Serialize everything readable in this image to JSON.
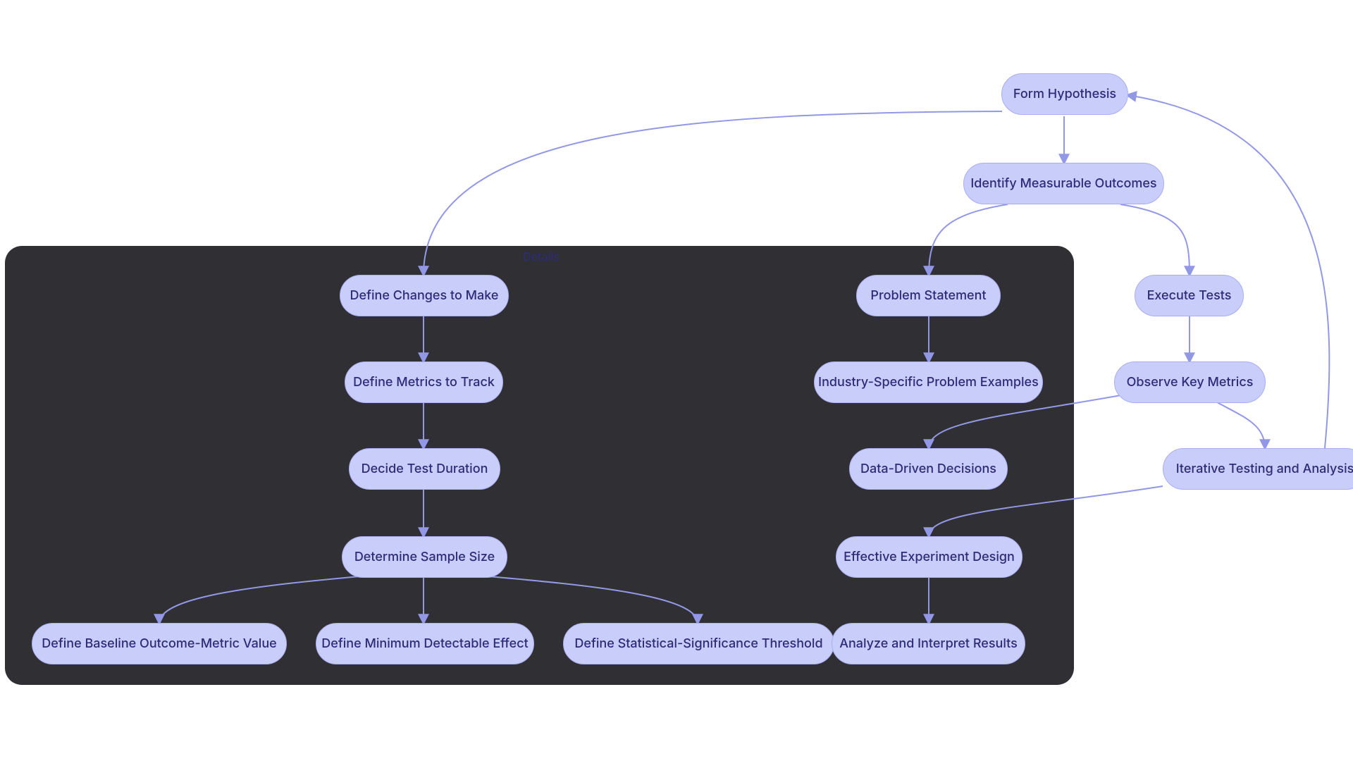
{
  "panel": {
    "label": "Details"
  },
  "nodes": {
    "form_hypothesis": "Form Hypothesis",
    "identify_measurable": "Identify Measurable Outcomes",
    "define_changes": "Define Changes to Make",
    "define_metrics": "Define Metrics to Track",
    "decide_duration": "Decide Test Duration",
    "determine_sample": "Determine Sample Size",
    "baseline": "Define Baseline Outcome-Metric Value",
    "mde": "Define Minimum Detectable Effect",
    "stat_sig": "Define Statistical-Significance Threshold",
    "problem_statement": "Problem Statement",
    "industry_examples": "Industry-Specific Problem Examples",
    "data_driven": "Data-Driven Decisions",
    "effective_design": "Effective Experiment Design",
    "analyze_results": "Analyze and Interpret Results",
    "execute_tests": "Execute Tests",
    "observe_metrics": "Observe Key Metrics",
    "iterative": "Iterative Testing and Analysis"
  }
}
